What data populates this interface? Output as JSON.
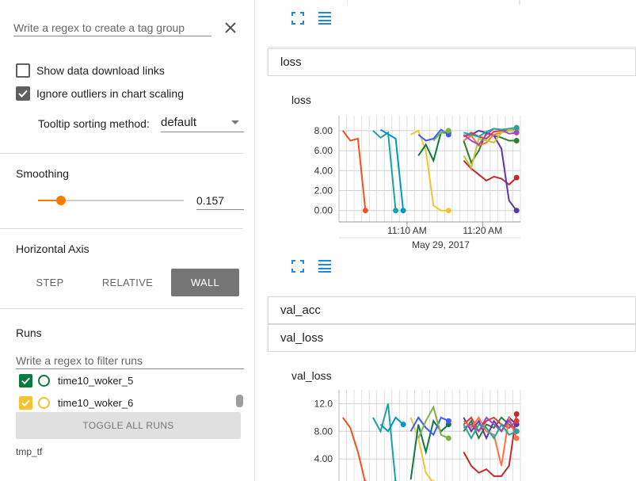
{
  "sidebar": {
    "tag_regex_placeholder": "Write a regex to create a tag group",
    "show_download_label": "Show data download links",
    "ignore_outliers_label": "Ignore outliers in chart scaling",
    "tooltip_label": "Tooltip sorting method:",
    "tooltip_value": "default",
    "smoothing_label": "Smoothing",
    "smoothing_value": "0.157",
    "smoothing_fraction": 0.157,
    "horizontal_axis_label": "Horizontal Axis",
    "axis_options": [
      "STEP",
      "RELATIVE",
      "WALL"
    ],
    "axis_selected": "WALL",
    "runs_label": "Runs",
    "runs_filter_placeholder": "Write a regex to filter runs",
    "runs": [
      {
        "name": "time10_woker_5",
        "color": "#0b7a3e",
        "checked": true
      },
      {
        "name": "time10_woker_6",
        "color": "#f4c430",
        "checked": true
      }
    ],
    "toggle_all_label": "TOGGLE ALL RUNS",
    "logdir": "tmp_tf"
  },
  "main": {
    "groups": [
      {
        "label": "loss"
      },
      {
        "label": "val_acc"
      },
      {
        "label": "val_loss"
      }
    ]
  },
  "chart_data": [
    {
      "type": "line",
      "title": "loss",
      "y_ticks": [
        "8.00",
        "6.00",
        "4.00",
        "2.00",
        "0.00"
      ],
      "x_ticks": [
        "11:10 AM",
        "11:20 AM"
      ],
      "x_axis_date": "May 29, 2017",
      "ylim": [
        -0.5,
        9.5
      ],
      "grid": true,
      "series": [
        {
          "color": "#f4511e",
          "points": [
            [
              0,
              8.0
            ],
            [
              1,
              7.0
            ],
            [
              2,
              7.2
            ],
            [
              3,
              0.0
            ]
          ]
        },
        {
          "color": "#1aa3a3",
          "points": [
            [
              4,
              8.0
            ],
            [
              5,
              7.3
            ],
            [
              6,
              7.8
            ],
            [
              7,
              0.0
            ]
          ]
        },
        {
          "color": "#0097c6",
          "points": [
            [
              5,
              8.1
            ],
            [
              7,
              7.2
            ],
            [
              8,
              0.0
            ]
          ]
        },
        {
          "color": "#f4c430",
          "points": [
            [
              9,
              7.6
            ],
            [
              10,
              8.0
            ],
            [
              11,
              6.0
            ],
            [
              12,
              0.5
            ],
            [
              13,
              0.0
            ],
            [
              14,
              0.0
            ]
          ]
        },
        {
          "color": "#0b7a3e",
          "points": [
            [
              10,
              5.5
            ],
            [
              11,
              6.6
            ],
            [
              12,
              5.0
            ],
            [
              13,
              7.8
            ],
            [
              14,
              7.8
            ]
          ]
        },
        {
          "color": "#3d5afe",
          "points": [
            [
              10,
              7.6
            ],
            [
              11,
              7.0
            ],
            [
              12,
              7.2
            ],
            [
              13,
              8.1
            ],
            [
              14,
              7.6
            ]
          ]
        },
        {
          "color": "#7cb342",
          "points": [
            [
              12,
              7.0
            ],
            [
              13,
              7.8
            ],
            [
              14,
              8.0
            ]
          ]
        },
        {
          "color": "#c62828",
          "points": [
            [
              16,
              5.0
            ],
            [
              17,
              4.2
            ],
            [
              18,
              3.6
            ],
            [
              19,
              3.0
            ],
            [
              20,
              3.4
            ],
            [
              21,
              3.2
            ],
            [
              22,
              2.6
            ],
            [
              23,
              3.3
            ]
          ]
        },
        {
          "color": "#2e7d32",
          "points": [
            [
              16,
              7.0
            ],
            [
              17,
              4.8
            ],
            [
              18,
              6.0
            ],
            [
              19,
              7.8
            ],
            [
              20,
              7.5
            ],
            [
              21,
              7.3
            ],
            [
              22,
              7.0
            ],
            [
              23,
              7.0
            ]
          ]
        },
        {
          "color": "#5e35b1",
          "points": [
            [
              16,
              7.5
            ],
            [
              17,
              7.6
            ],
            [
              18,
              8.0
            ],
            [
              19,
              7.8
            ],
            [
              20,
              7.5
            ],
            [
              21,
              6.2
            ],
            [
              22,
              1.0
            ],
            [
              23,
              0.0
            ]
          ]
        },
        {
          "color": "#e53935",
          "points": [
            [
              16,
              7.4
            ],
            [
              17,
              7.8
            ],
            [
              18,
              7.4
            ],
            [
              19,
              7.2
            ],
            [
              20,
              7.9
            ],
            [
              21,
              8.0
            ],
            [
              22,
              8.0
            ],
            [
              23,
              8.1
            ]
          ]
        },
        {
          "color": "#ff7043",
          "points": [
            [
              16,
              7.0
            ],
            [
              17,
              7.5
            ],
            [
              18,
              6.5
            ],
            [
              19,
              6.8
            ],
            [
              20,
              7.6
            ],
            [
              21,
              7.8
            ],
            [
              22,
              8.0
            ],
            [
              23,
              8.0
            ]
          ]
        },
        {
          "color": "#c0ca33",
          "points": [
            [
              16,
              5.5
            ],
            [
              17,
              4.3
            ],
            [
              18,
              7.2
            ],
            [
              19,
              7.0
            ],
            [
              20,
              6.8
            ],
            [
              21,
              7.8
            ],
            [
              22,
              8.0
            ],
            [
              23,
              8.0
            ]
          ]
        },
        {
          "color": "#ab47bc",
          "points": [
            [
              16,
              7.6
            ],
            [
              17,
              7.0
            ],
            [
              18,
              6.6
            ],
            [
              19,
              7.6
            ],
            [
              20,
              8.2
            ],
            [
              21,
              8.1
            ],
            [
              22,
              7.7
            ],
            [
              23,
              7.8
            ]
          ]
        },
        {
          "color": "#26a69a",
          "points": [
            [
              16,
              7.8
            ],
            [
              17,
              7.6
            ],
            [
              18,
              7.4
            ],
            [
              19,
              7.9
            ],
            [
              20,
              8.2
            ],
            [
              21,
              8.1
            ],
            [
              22,
              8.2
            ],
            [
              23,
              8.3
            ]
          ]
        }
      ]
    },
    {
      "type": "line",
      "title": "val_loss",
      "y_ticks": [
        "12.0",
        "8.00",
        "4.00"
      ],
      "ylim": [
        0,
        14
      ],
      "grid": true,
      "series": [
        {
          "color": "#f4511e",
          "points": [
            [
              0,
              10.0
            ],
            [
              1,
              8.5
            ],
            [
              2,
              5.0
            ],
            [
              3,
              0.5
            ]
          ]
        },
        {
          "color": "#1aa3a3",
          "points": [
            [
              4,
              10.0
            ],
            [
              5,
              8.0
            ],
            [
              6,
              12.0
            ],
            [
              7,
              0.5
            ]
          ]
        },
        {
          "color": "#0097c6",
          "points": [
            [
              5,
              9.0
            ],
            [
              6,
              8.0
            ],
            [
              7,
              10.0
            ],
            [
              8,
              9.0
            ]
          ]
        },
        {
          "color": "#f4c430",
          "points": [
            [
              9,
              10.0
            ],
            [
              10,
              7.0
            ],
            [
              11,
              2.0
            ],
            [
              12,
              0.5
            ]
          ]
        },
        {
          "color": "#0b7a3e",
          "points": [
            [
              9,
              1.0
            ],
            [
              10,
              9.0
            ],
            [
              11,
              5.0
            ],
            [
              12,
              9.5
            ],
            [
              13,
              8.0
            ],
            [
              14,
              9.0
            ]
          ]
        },
        {
          "color": "#3d5afe",
          "points": [
            [
              9,
              8.0
            ],
            [
              10,
              10.0
            ],
            [
              11,
              8.5
            ],
            [
              12,
              7.5
            ],
            [
              13,
              10.0
            ],
            [
              14,
              9.5
            ]
          ]
        },
        {
          "color": "#7cb342",
          "points": [
            [
              10,
              7.0
            ],
            [
              11,
              9.5
            ],
            [
              12,
              11.5
            ],
            [
              13,
              7.5
            ],
            [
              14,
              7.0
            ]
          ]
        },
        {
          "color": "#c62828",
          "points": [
            [
              16,
              5.0
            ],
            [
              17,
              3.0
            ],
            [
              18,
              2.0
            ],
            [
              19,
              2.5
            ],
            [
              20,
              1.5
            ],
            [
              21,
              1.5
            ],
            [
              22,
              3.0
            ],
            [
              23,
              10.5
            ]
          ]
        },
        {
          "color": "#2e7d32",
          "points": [
            [
              16,
              8.0
            ],
            [
              17,
              9.5
            ],
            [
              18,
              7.0
            ],
            [
              19,
              9.0
            ],
            [
              20,
              8.5
            ],
            [
              21,
              10.0
            ],
            [
              22,
              9.0
            ],
            [
              23,
              8.0
            ]
          ]
        },
        {
          "color": "#5e35b1",
          "points": [
            [
              16,
              10.0
            ],
            [
              17,
              8.0
            ],
            [
              18,
              9.5
            ],
            [
              19,
              7.0
            ],
            [
              20,
              9.5
            ],
            [
              21,
              8.0
            ],
            [
              22,
              10.0
            ],
            [
              23,
              9.0
            ]
          ]
        },
        {
          "color": "#e53935",
          "points": [
            [
              16,
              9.0
            ],
            [
              17,
              10.0
            ],
            [
              18,
              8.0
            ],
            [
              19,
              9.5
            ],
            [
              20,
              10.0
            ],
            [
              21,
              9.0
            ],
            [
              22,
              8.5
            ],
            [
              23,
              9.5
            ]
          ]
        },
        {
          "color": "#ff7043",
          "points": [
            [
              16,
              9.5
            ],
            [
              17,
              8.5
            ],
            [
              18,
              10.0
            ],
            [
              19,
              8.0
            ],
            [
              20,
              7.5
            ],
            [
              21,
              3.0
            ],
            [
              22,
              10.0
            ],
            [
              23,
              7.0
            ]
          ]
        },
        {
          "color": "#ab47bc",
          "points": [
            [
              16,
              8.5
            ],
            [
              17,
              9.0
            ],
            [
              18,
              8.0
            ],
            [
              19,
              10.0
            ],
            [
              20,
              9.0
            ],
            [
              21,
              8.0
            ],
            [
              22,
              9.5
            ],
            [
              23,
              8.0
            ]
          ]
        },
        {
          "color": "#26a69a",
          "points": [
            [
              16,
              9.0
            ],
            [
              17,
              7.0
            ],
            [
              18,
              9.0
            ],
            [
              19,
              8.5
            ],
            [
              20,
              7.0
            ],
            [
              21,
              9.0
            ],
            [
              22,
              7.5
            ],
            [
              23,
              8.0
            ]
          ]
        }
      ]
    }
  ]
}
